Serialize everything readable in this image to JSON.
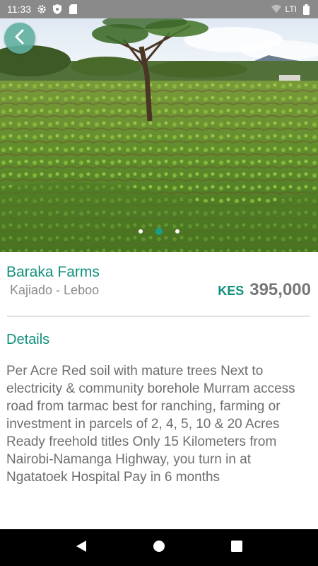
{
  "status_bar": {
    "time": "11:33",
    "carrier": "LTI",
    "icons": [
      "gear-icon",
      "shield-icon",
      "sd-card-icon",
      "wifi-icon",
      "battery-icon"
    ]
  },
  "hero": {
    "image": "photo of green farmland with acacia tree and distant hills",
    "carousel": {
      "total": 3,
      "active_index": 1
    }
  },
  "listing": {
    "title": "Baraka Farms",
    "location": "Kajiado - Leboo",
    "currency": "KES",
    "price": "395,000"
  },
  "details": {
    "heading": "Details",
    "description": "Per Acre Red soil with mature trees Next to electricity & community borehole Murram access road from tarmac best for ranching, farming or investment in parcels of 2, 4, 5, 10 & 20 Acres Ready freehold titles Only 15 Kilometers from Nairobi-Namanga Highway, you turn in at Ngatatoek Hospital Pay in 6 months"
  },
  "colors": {
    "accent": "#10907c",
    "back_button": "#5fafa0",
    "secondary_text": "#8c8c8c"
  }
}
